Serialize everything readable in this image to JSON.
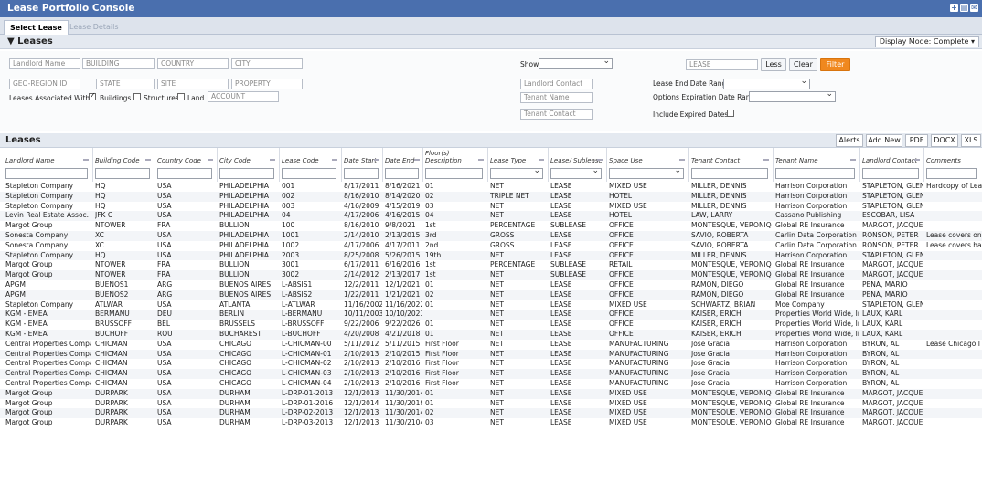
{
  "app": {
    "title": "Lease Portfolio Console"
  },
  "tabs": [
    {
      "label": "Select Lease"
    },
    {
      "label": "Lease Details"
    }
  ],
  "leases_section": {
    "label": "Leases",
    "display_mode": "Display Mode: Complete"
  },
  "filters": {
    "landlord_name": "Landlord Name",
    "building": "BUILDING",
    "country": "COUNTRY",
    "city": "CITY",
    "geo_region_id": "GEO-REGION ID",
    "state": "STATE",
    "site": "SITE",
    "property": "PROPERTY",
    "show_label": "Show",
    "lease": "LEASE",
    "less_button": "Less",
    "clear_button": "Clear",
    "filter_button": "Filter",
    "landlord_contact": "Landlord Contact",
    "tenant_name": "Tenant Name",
    "tenant_contact": "Tenant Contact",
    "lease_end_date_range": "Lease End Date Range",
    "options_expiration_date_range": "Options Expiration Date Range",
    "include_expired_dates": "Include Expired Dates",
    "leases_associated_with": "Leases Associated With",
    "buildings": "Buildings",
    "structures": "Structures",
    "land": "Land",
    "account": "ACCOUNT"
  },
  "grid": {
    "title": "Leases",
    "buttons": [
      "Alerts",
      "Add New",
      "PDF",
      "DOCX",
      "XLS"
    ],
    "columns": [
      "Landlord Name",
      "Building Code",
      "Country Code",
      "City Code",
      "Lease Code",
      "Date Start",
      "Date End",
      "Floor(s) Description",
      "Lease Type",
      "Lease/ Sublease",
      "Space Use",
      "Tenant Contact",
      "Tenant Name",
      "Landlord Contact",
      "Comments"
    ],
    "rows": [
      [
        "Stapleton Company",
        "HQ",
        "USA",
        "PHILADELPHIA",
        "001",
        "8/17/2011",
        "8/16/2021",
        "01",
        "NET",
        "LEASE",
        "MIXED USE",
        "MILLER, DENNIS",
        "Harrison Corporation",
        "STAPLETON, GLEN",
        "Hardcopy of Lea"
      ],
      [
        "Stapleton Company",
        "HQ",
        "USA",
        "PHILADELPHIA",
        "002",
        "8/16/2010",
        "8/14/2020",
        "02",
        "TRIPLE NET",
        "LEASE",
        "HOTEL",
        "MILLER, DENNIS",
        "Harrison Corporation",
        "STAPLETON, GLEN",
        ""
      ],
      [
        "Stapleton Company",
        "HQ",
        "USA",
        "PHILADELPHIA",
        "003",
        "4/16/2009",
        "4/15/2019",
        "03",
        "NET",
        "LEASE",
        "MIXED USE",
        "MILLER, DENNIS",
        "Harrison Corporation",
        "STAPLETON, GLEN",
        ""
      ],
      [
        "Levin Real Estate Assoc.",
        "JFK C",
        "USA",
        "PHILADELPHIA",
        "04",
        "4/17/2006",
        "4/16/2015",
        "04",
        "NET",
        "LEASE",
        "HOTEL",
        "LAW, LARRY",
        "Cassano Publishing",
        "ESCOBAR, LISA",
        ""
      ],
      [
        "Margot Group",
        "NTOWER",
        "FRA",
        "BULLION",
        "100",
        "8/16/2010",
        "9/8/2021",
        "1st",
        "PERCENTAGE",
        "SUBLEASE",
        "OFFICE",
        "MONTESQUE, VERONIQUE",
        "Global RE Insurance",
        "MARGOT, JACQUES",
        ""
      ],
      [
        "Sonesta Company",
        "XC",
        "USA",
        "PHILADELPHIA",
        "1001",
        "2/14/2010",
        "2/13/2015",
        "3rd",
        "GROSS",
        "LEASE",
        "OFFICE",
        "SAVIO, ROBERTA",
        "Carlin Data Corporation",
        "RONSON, PETER",
        "Lease covers on"
      ],
      [
        "Sonesta Company",
        "XC",
        "USA",
        "PHILADELPHIA",
        "1002",
        "4/17/2006",
        "4/17/2011",
        "2nd",
        "GROSS",
        "LEASE",
        "OFFICE",
        "SAVIO, ROBERTA",
        "Carlin Data Corporation",
        "RONSON, PETER",
        "Lease covers ha"
      ],
      [
        "Stapleton Company",
        "HQ",
        "USA",
        "PHILADELPHIA",
        "2003",
        "8/25/2008",
        "5/26/2015",
        "19th",
        "NET",
        "LEASE",
        "OFFICE",
        "MILLER, DENNIS",
        "Harrison Corporation",
        "STAPLETON, GLEN",
        ""
      ],
      [
        "Margot Group",
        "NTOWER",
        "FRA",
        "BULLION",
        "3001",
        "6/17/2011",
        "6/16/2016",
        "1st",
        "PERCENTAGE",
        "SUBLEASE",
        "RETAIL",
        "MONTESQUE, VERONIQUE",
        "Global RE Insurance",
        "MARGOT, JACQUES",
        ""
      ],
      [
        "Margot Group",
        "NTOWER",
        "FRA",
        "BULLION",
        "3002",
        "2/14/2012",
        "2/13/2017",
        "1st",
        "NET",
        "SUBLEASE",
        "OFFICE",
        "MONTESQUE, VERONIQUE",
        "Global RE Insurance",
        "MARGOT, JACQUES",
        ""
      ],
      [
        "APGM",
        "BUENOS1",
        "ARG",
        "BUENOS AIRES",
        "L-ABSIS1",
        "12/2/2011",
        "12/1/2021",
        "01",
        "NET",
        "LEASE",
        "OFFICE",
        "RAMON, DIEGO",
        "Global RE Insurance",
        "PENA, MARIO",
        ""
      ],
      [
        "APGM",
        "BUENOS2",
        "ARG",
        "BUENOS AIRES",
        "L-ABSIS2",
        "1/22/2011",
        "1/21/2021",
        "02",
        "NET",
        "LEASE",
        "OFFICE",
        "RAMON, DIEGO",
        "Global RE Insurance",
        "PENA, MARIO",
        ""
      ],
      [
        "Stapleton Company",
        "ATLWAR",
        "USA",
        "ATLANTA",
        "L-ATLWAR",
        "11/16/2002",
        "11/16/2022",
        "01",
        "NET",
        "LEASE",
        "MIXED USE",
        "SCHWARTZ, BRIAN",
        "Moe Company",
        "STAPLETON, GLEN",
        ""
      ],
      [
        "KGM - EMEA",
        "BERMANU",
        "DEU",
        "BERLIN",
        "L-BERMANU",
        "10/11/2003",
        "10/10/2023",
        "",
        "NET",
        "LEASE",
        "OFFICE",
        "KAISER, ERICH",
        "Properties World Wide, Inc.",
        "LAUX, KARL",
        ""
      ],
      [
        "KGM - EMEA",
        "BRUSSOFF",
        "BEL",
        "BRUSSELS",
        "L-BRUSSOFF",
        "9/22/2006",
        "9/22/2026",
        "01",
        "NET",
        "LEASE",
        "OFFICE",
        "KAISER, ERICH",
        "Properties World Wide, Inc.",
        "LAUX, KARL",
        ""
      ],
      [
        "KGM - EMEA",
        "BUCHOFF",
        "ROU",
        "BUCHAREST",
        "L-BUCHOFF",
        "4/20/2008",
        "4/21/2018",
        "01",
        "NET",
        "LEASE",
        "OFFICE",
        "KAISER, ERICH",
        "Properties World Wide, Inc.",
        "LAUX, KARL",
        ""
      ],
      [
        "Central Properties Company",
        "CHICMAN",
        "USA",
        "CHICAGO",
        "L-CHICMAN-00",
        "5/11/2012",
        "5/11/2015",
        "First Floor",
        "NET",
        "LEASE",
        "MANUFACTURING",
        "Jose Gracia",
        "Harrison Corporation",
        "BYRON, AL",
        "Lease Chicago I"
      ],
      [
        "Central Properties Company",
        "CHICMAN",
        "USA",
        "CHICAGO",
        "L-CHICMAN-01",
        "2/10/2013",
        "2/10/2015",
        "First Floor",
        "NET",
        "LEASE",
        "MANUFACTURING",
        "Jose Gracia",
        "Harrison Corporation",
        "BYRON, AL",
        ""
      ],
      [
        "Central Properties Company",
        "CHICMAN",
        "USA",
        "CHICAGO",
        "L-CHICMAN-02",
        "2/10/2013",
        "2/10/2016",
        "First Floor",
        "NET",
        "LEASE",
        "MANUFACTURING",
        "Jose Gracia",
        "Harrison Corporation",
        "BYRON, AL",
        ""
      ],
      [
        "Central Properties Company",
        "CHICMAN",
        "USA",
        "CHICAGO",
        "L-CHICMAN-03",
        "2/10/2013",
        "2/10/2016",
        "First Floor",
        "NET",
        "LEASE",
        "MANUFACTURING",
        "Jose Gracia",
        "Harrison Corporation",
        "BYRON, AL",
        ""
      ],
      [
        "Central Properties Company",
        "CHICMAN",
        "USA",
        "CHICAGO",
        "L-CHICMAN-04",
        "2/10/2013",
        "2/10/2016",
        "First Floor",
        "NET",
        "LEASE",
        "MANUFACTURING",
        "Jose Gracia",
        "Harrison Corporation",
        "BYRON, AL",
        ""
      ],
      [
        "Margot Group",
        "DURPARK",
        "USA",
        "DURHAM",
        "L-DRP-01-2013",
        "12/1/2013",
        "11/30/2014",
        "01",
        "NET",
        "LEASE",
        "MIXED USE",
        "MONTESQUE, VERONIQUE",
        "Global RE Insurance",
        "MARGOT, JACQUES",
        ""
      ],
      [
        "Margot Group",
        "DURPARK",
        "USA",
        "DURHAM",
        "L-DRP-01-2016",
        "12/1/2014",
        "11/30/2019",
        "01",
        "NET",
        "LEASE",
        "MIXED USE",
        "MONTESQUE, VERONIQUE",
        "Global RE Insurance",
        "MARGOT, JACQUES",
        ""
      ],
      [
        "Margot Group",
        "DURPARK",
        "USA",
        "DURHAM",
        "L-DRP-02-2013",
        "12/1/2013",
        "11/30/2014",
        "02",
        "NET",
        "LEASE",
        "MIXED USE",
        "MONTESQUE, VERONIQUE",
        "Global RE Insurance",
        "MARGOT, JACQUES",
        ""
      ],
      [
        "Margot Group",
        "DURPARK",
        "USA",
        "DURHAM",
        "L-DRP-03-2013",
        "12/1/2013",
        "11/30/2104",
        "03",
        "NET",
        "LEASE",
        "MIXED USE",
        "MONTESQUE, VERONIQUE",
        "Global RE Insurance",
        "MARGOT, JACQUES",
        ""
      ]
    ]
  }
}
